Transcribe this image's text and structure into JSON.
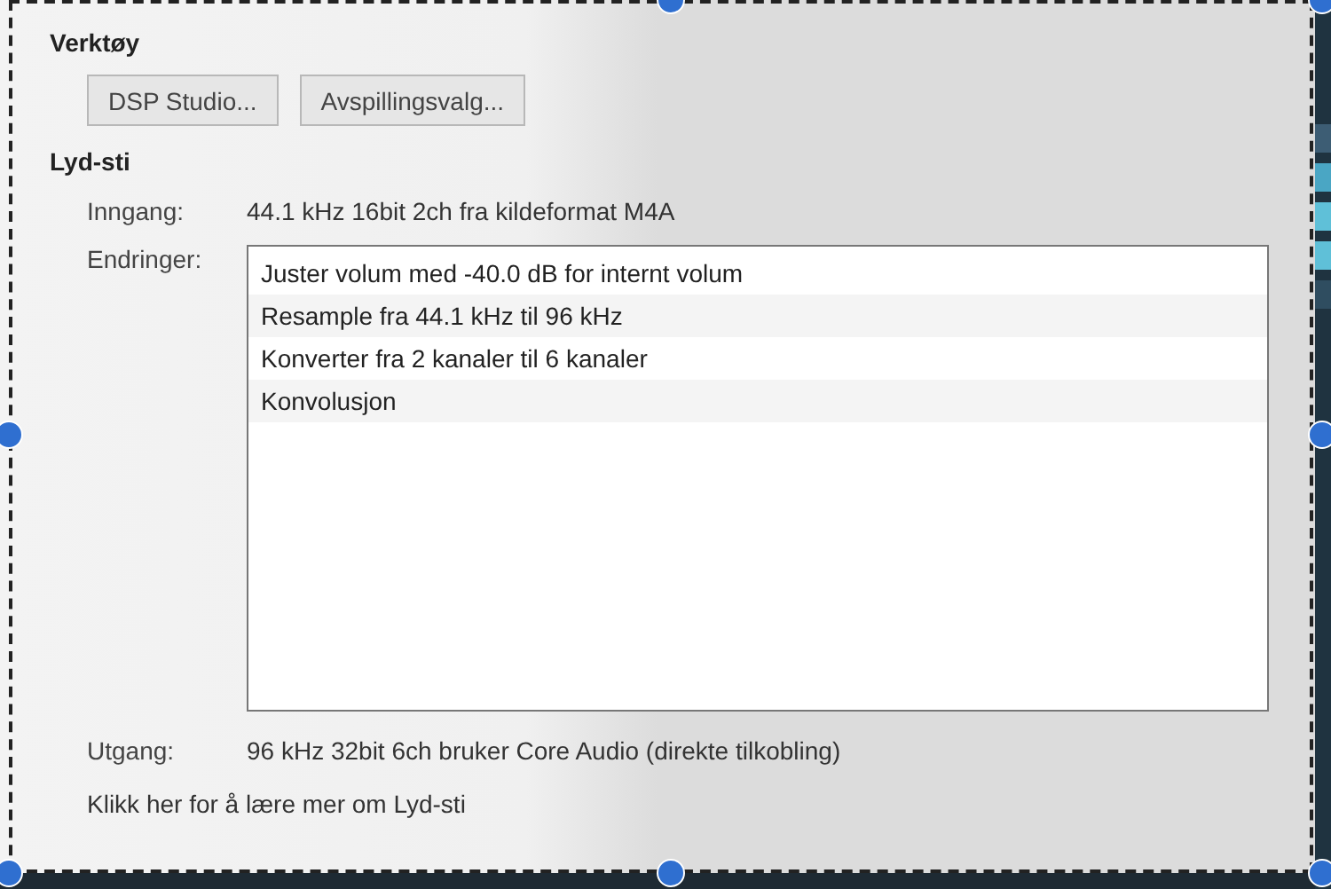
{
  "tools": {
    "heading": "Verktøy",
    "buttons": [
      "DSP Studio...",
      "Avspillingsvalg..."
    ]
  },
  "audio_path": {
    "heading": "Lyd-sti",
    "input": {
      "label": "Inngang:",
      "value": "44.1 kHz 16bit 2ch fra kildeformat M4A"
    },
    "changes": {
      "label": "Endringer:",
      "items": [
        "Juster volum med -40.0 dB for internt volum",
        "Resample fra 44.1 kHz til 96 kHz",
        "Konverter fra 2 kanaler til 6 kanaler",
        "Konvolusjon"
      ]
    },
    "output": {
      "label": "Utgang:",
      "value": "96 kHz 32bit 6ch bruker Core Audio (direkte tilkobling)"
    },
    "help_link": "Klikk her for å lære mer om Lyd-sti"
  }
}
